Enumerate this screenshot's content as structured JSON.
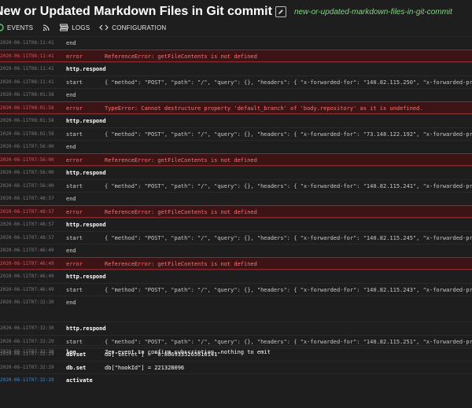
{
  "header": {
    "title": "New or Updated Markdown Files in Git commit",
    "slug": "new-or-updated-markdown-files-in-git-commit"
  },
  "tabs": [
    {
      "label": "EVENTS",
      "icon": "rss-icon"
    },
    {
      "label": "LOGS",
      "icon": "logs-icon"
    },
    {
      "label": "CONFIGURATION",
      "icon": "code-icon"
    }
  ],
  "rows": [
    {
      "kind": "normal",
      "ts": "2020-06-11T08:11:41",
      "type": "end",
      "msg": ""
    },
    {
      "kind": "error",
      "ts": "2020-06-11T08:11:41",
      "type": "error",
      "msg": "ReferenceError: getFileContents is not defined"
    },
    {
      "kind": "bold",
      "ts": "2020-06-11T08:11:41",
      "type": "http.respond",
      "msg": ""
    },
    {
      "kind": "start",
      "ts": "2020-06-11T08:11:41",
      "type": "start",
      "msg": "{ \"method\": \"POST\", \"path\": \"/\", \"query\": {}, \"headers\": { \"x-forwarded-for\": \"140.82.115.250\", \"x-forwarded-proto\""
    },
    {
      "kind": "normal",
      "ts": "2020-06-11T08:01:58",
      "type": "end",
      "msg": ""
    },
    {
      "kind": "error",
      "ts": "2020-06-11T08:01:58",
      "type": "error",
      "msg": "TypeError: Cannot destructure property 'default_branch' of 'body.repository' as it is undefined."
    },
    {
      "kind": "bold",
      "ts": "2020-06-11T08:01:58",
      "type": "http.respond",
      "msg": ""
    },
    {
      "kind": "start",
      "ts": "2020-06-11T08:01:58",
      "type": "start",
      "msg": "{ \"method\": \"POST\", \"path\": \"/\", \"query\": {}, \"headers\": { \"x-forwarded-for\": \"73.148.122.192\", \"x-forwarded-proto\""
    },
    {
      "kind": "normal",
      "ts": "2020-06-11T07:56:00",
      "type": "end",
      "msg": ""
    },
    {
      "kind": "error",
      "ts": "2020-06-11T07:56:00",
      "type": "error",
      "msg": "ReferenceError: getFileContents is not defined"
    },
    {
      "kind": "bold",
      "ts": "2020-06-11T07:56:00",
      "type": "http.respond",
      "msg": ""
    },
    {
      "kind": "start",
      "ts": "2020-06-11T07:56:00",
      "type": "start",
      "msg": "{ \"method\": \"POST\", \"path\": \"/\", \"query\": {}, \"headers\": { \"x-forwarded-for\": \"140.82.115.241\", \"x-forwarded-proto\""
    },
    {
      "kind": "normal",
      "ts": "2020-06-11T07:48:57",
      "type": "end",
      "msg": ""
    },
    {
      "kind": "error",
      "ts": "2020-06-11T07:48:57",
      "type": "error",
      "msg": "ReferenceError: getFileContents is not defined"
    },
    {
      "kind": "bold",
      "ts": "2020-06-11T07:48:57",
      "type": "http.respond",
      "msg": ""
    },
    {
      "kind": "start",
      "ts": "2020-06-11T07:48:57",
      "type": "start",
      "msg": "{ \"method\": \"POST\", \"path\": \"/\", \"query\": {}, \"headers\": { \"x-forwarded-for\": \"140.82.115.245\", \"x-forwarded-proto\""
    },
    {
      "kind": "normal",
      "ts": "2020-06-11T07:46:49",
      "type": "end",
      "msg": ""
    },
    {
      "kind": "error",
      "ts": "2020-06-11T07:46:49",
      "type": "error",
      "msg": "ReferenceError: getFileContents is not defined"
    },
    {
      "kind": "bold",
      "ts": "2020-06-11T07:46:49",
      "type": "http.respond",
      "msg": ""
    },
    {
      "kind": "start",
      "ts": "2020-06-11T07:46:49",
      "type": "start",
      "msg": "{ \"method\": \"POST\", \"path\": \"/\", \"query\": {}, \"headers\": { \"x-forwarded-for\": \"140.82.115.243\", \"x-forwarded-proto\""
    },
    {
      "kind": "normal",
      "ts": "2020-06-11T07:32:30",
      "type": "end",
      "msg": ""
    },
    {
      "kind": "log",
      "ts": "2020-06-11T07:32:30",
      "type": "log",
      "msg": "Zen event to confirm subscription, nothing to emit"
    },
    {
      "kind": "bold",
      "ts": "2020-06-11T07:32:30",
      "type": "http.respond",
      "msg": ""
    },
    {
      "kind": "start",
      "ts": "2020-06-11T07:32:29",
      "type": "start",
      "msg": "{ \"method\": \"POST\", \"path\": \"/\", \"query\": {}, \"headers\": { \"x-forwarded-for\": \"140.82.115.251\", \"x-forwarded-proto\""
    },
    {
      "kind": "dbset",
      "ts": "2020-06-11T07:32:29",
      "type": "db.set",
      "msg": "db[\"secret\"] = \"0.8669335265516141\""
    },
    {
      "kind": "dbset",
      "ts": "2020-06-11T07:32:29",
      "type": "db.set",
      "msg": "db[\"hookId\"] = 221328096"
    },
    {
      "kind": "activate",
      "ts": "2020-06-11T07:32:29",
      "type": "activate",
      "msg": ""
    }
  ]
}
